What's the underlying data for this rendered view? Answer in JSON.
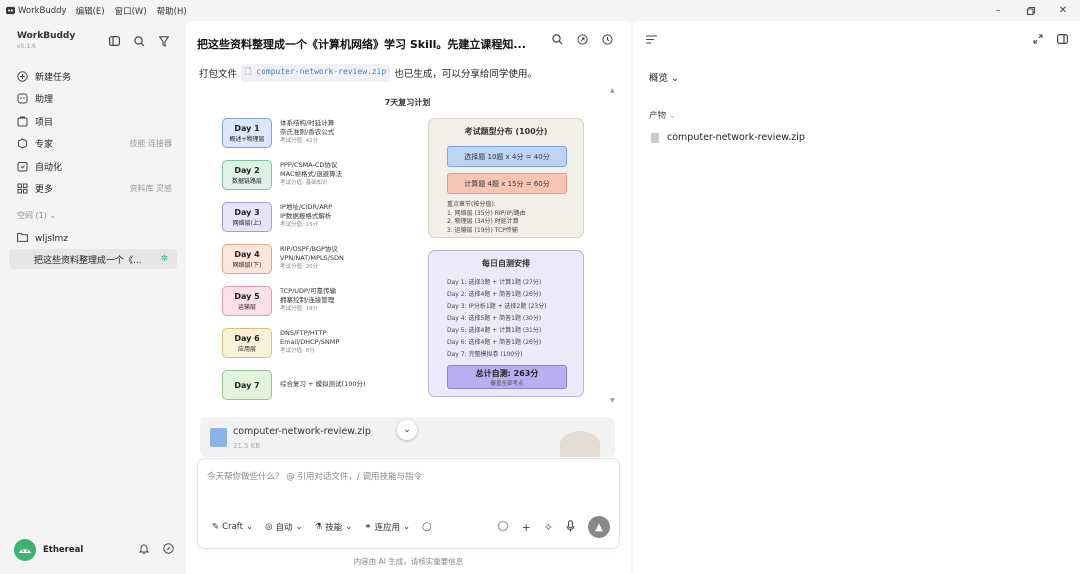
{
  "titlebar": {
    "app_name": "WorkBuddy",
    "menus": [
      "编辑(E)",
      "窗口(W)",
      "帮助(H)"
    ]
  },
  "sidebar": {
    "app_name": "WorkBuddy",
    "version": "v5.1.6",
    "nav": [
      {
        "label": "新建任务",
        "icon": "plus-circle-icon",
        "hint": ""
      },
      {
        "label": "助理",
        "icon": "assistant-icon",
        "hint": ""
      },
      {
        "label": "项目",
        "icon": "project-icon",
        "hint": ""
      },
      {
        "label": "专家",
        "icon": "expert-icon",
        "hint": "技能 连接器"
      },
      {
        "label": "自动化",
        "icon": "automation-icon",
        "hint": ""
      },
      {
        "label": "更多",
        "icon": "grid-icon",
        "hint": "资料库 灵感"
      }
    ],
    "space_label": "空间 (1)",
    "folder_name": "wljslmz",
    "conversation_title": "把这些资料整理成一个《...",
    "user_name": "Ethereal"
  },
  "chat": {
    "title": "把这些资料整理成一个《计算机网络》学习 Skill。先建立课程知...",
    "pack_prefix": "打包文件",
    "pack_file": "computer-network-review.zip",
    "pack_suffix": "也已生成，可以分享给同学使用。",
    "plan_title": "7天复习计划",
    "days": [
      {
        "name": "Day 1",
        "sub": "概述+物理层",
        "lines": [
          "体系结构/时延计算",
          "奈氏准则/香农公式"
        ],
        "score": "考试分值: 42分",
        "color": "#dbe8fa",
        "border": "#7aa6e0"
      },
      {
        "name": "Day 2",
        "sub": "数据链路层",
        "lines": [
          "PPP/CSMA-CD协议",
          "MAC帧格式/退避算法"
        ],
        "score": "考试分值: 基础知识",
        "color": "#dcf3e6",
        "border": "#7cc59a"
      },
      {
        "name": "Day 3",
        "sub": "网络层(上)",
        "lines": [
          "IP地址/CIDR/ARP",
          "IP数据报格式解析"
        ],
        "score": "考试分值: 15分",
        "color": "#e7e4fa",
        "border": "#a39ce0"
      },
      {
        "name": "Day 4",
        "sub": "网络层(下)",
        "lines": [
          "RIP/OSPF/BGP协议",
          "VPN/NAT/MPLS/SDN"
        ],
        "score": "考试分值: 20分",
        "color": "#fbe6dc",
        "border": "#e2a489"
      },
      {
        "name": "Day 5",
        "sub": "运输层",
        "lines": [
          "TCP/UDP/可靠传输",
          "拥塞控制/连接管理"
        ],
        "score": "考试分值: 19分",
        "color": "#fbe0ea",
        "border": "#e49ab5"
      },
      {
        "name": "Day 6",
        "sub": "应用层",
        "lines": [
          "DNS/FTP/HTTP",
          "Email/DHCP/SNMP"
        ],
        "score": "考试分值: 8分",
        "color": "#fbf0d8",
        "border": "#dfbe7c"
      },
      {
        "name": "Day 7",
        "sub": "",
        "lines": [
          "综合复习 + 模拟测试(100分)"
        ],
        "score": "",
        "color": "#e2f4dc",
        "border": "#92cb83"
      }
    ],
    "exam": {
      "title": "考试题型分布 (100分)",
      "box1": "选择题 10题 x 4分 = 40分",
      "box2": "计算题 4题 x 15分 = 60分",
      "notes": [
        "重点章节(按分值):",
        "1. 网络层 (35分) RIP/IP/路由",
        "2. 物理层 (34分) 时延计算",
        "3. 运输层 (19分) TCP传输"
      ]
    },
    "self_test": {
      "title": "每日自测安排",
      "items": [
        "Day 1: 选择3题 + 计算1题 (27分)",
        "Day 2: 选择4题 + 简答1题 (26分)",
        "Day 3: IP分析1题 + 选择2题 (23分)",
        "Day 4: 选择5题 + 简答1题 (30分)",
        "Day 5: 选择4题 + 计算1题 (31分)",
        "Day 6: 选择4题 + 简答1题 (26分)",
        "Day 7: 完整模拟卷 (100分)"
      ],
      "total": "总计自测: 263分",
      "total_sub": "覆盖全部考点"
    },
    "attachment": {
      "name": "computer-network-review.zip",
      "size": "21.5 KB"
    },
    "input_placeholder": "今天帮你做些什么？ @ 引用对话文件，/ 调用技能与指令",
    "tools": [
      "Craft",
      "自动",
      "技能",
      "连应用"
    ],
    "disclaimer": "内容由 AI 生成，请核实重要信息"
  },
  "panel": {
    "overview_label": "概览",
    "products_label": "产物",
    "file": "computer-network-review.zip"
  }
}
